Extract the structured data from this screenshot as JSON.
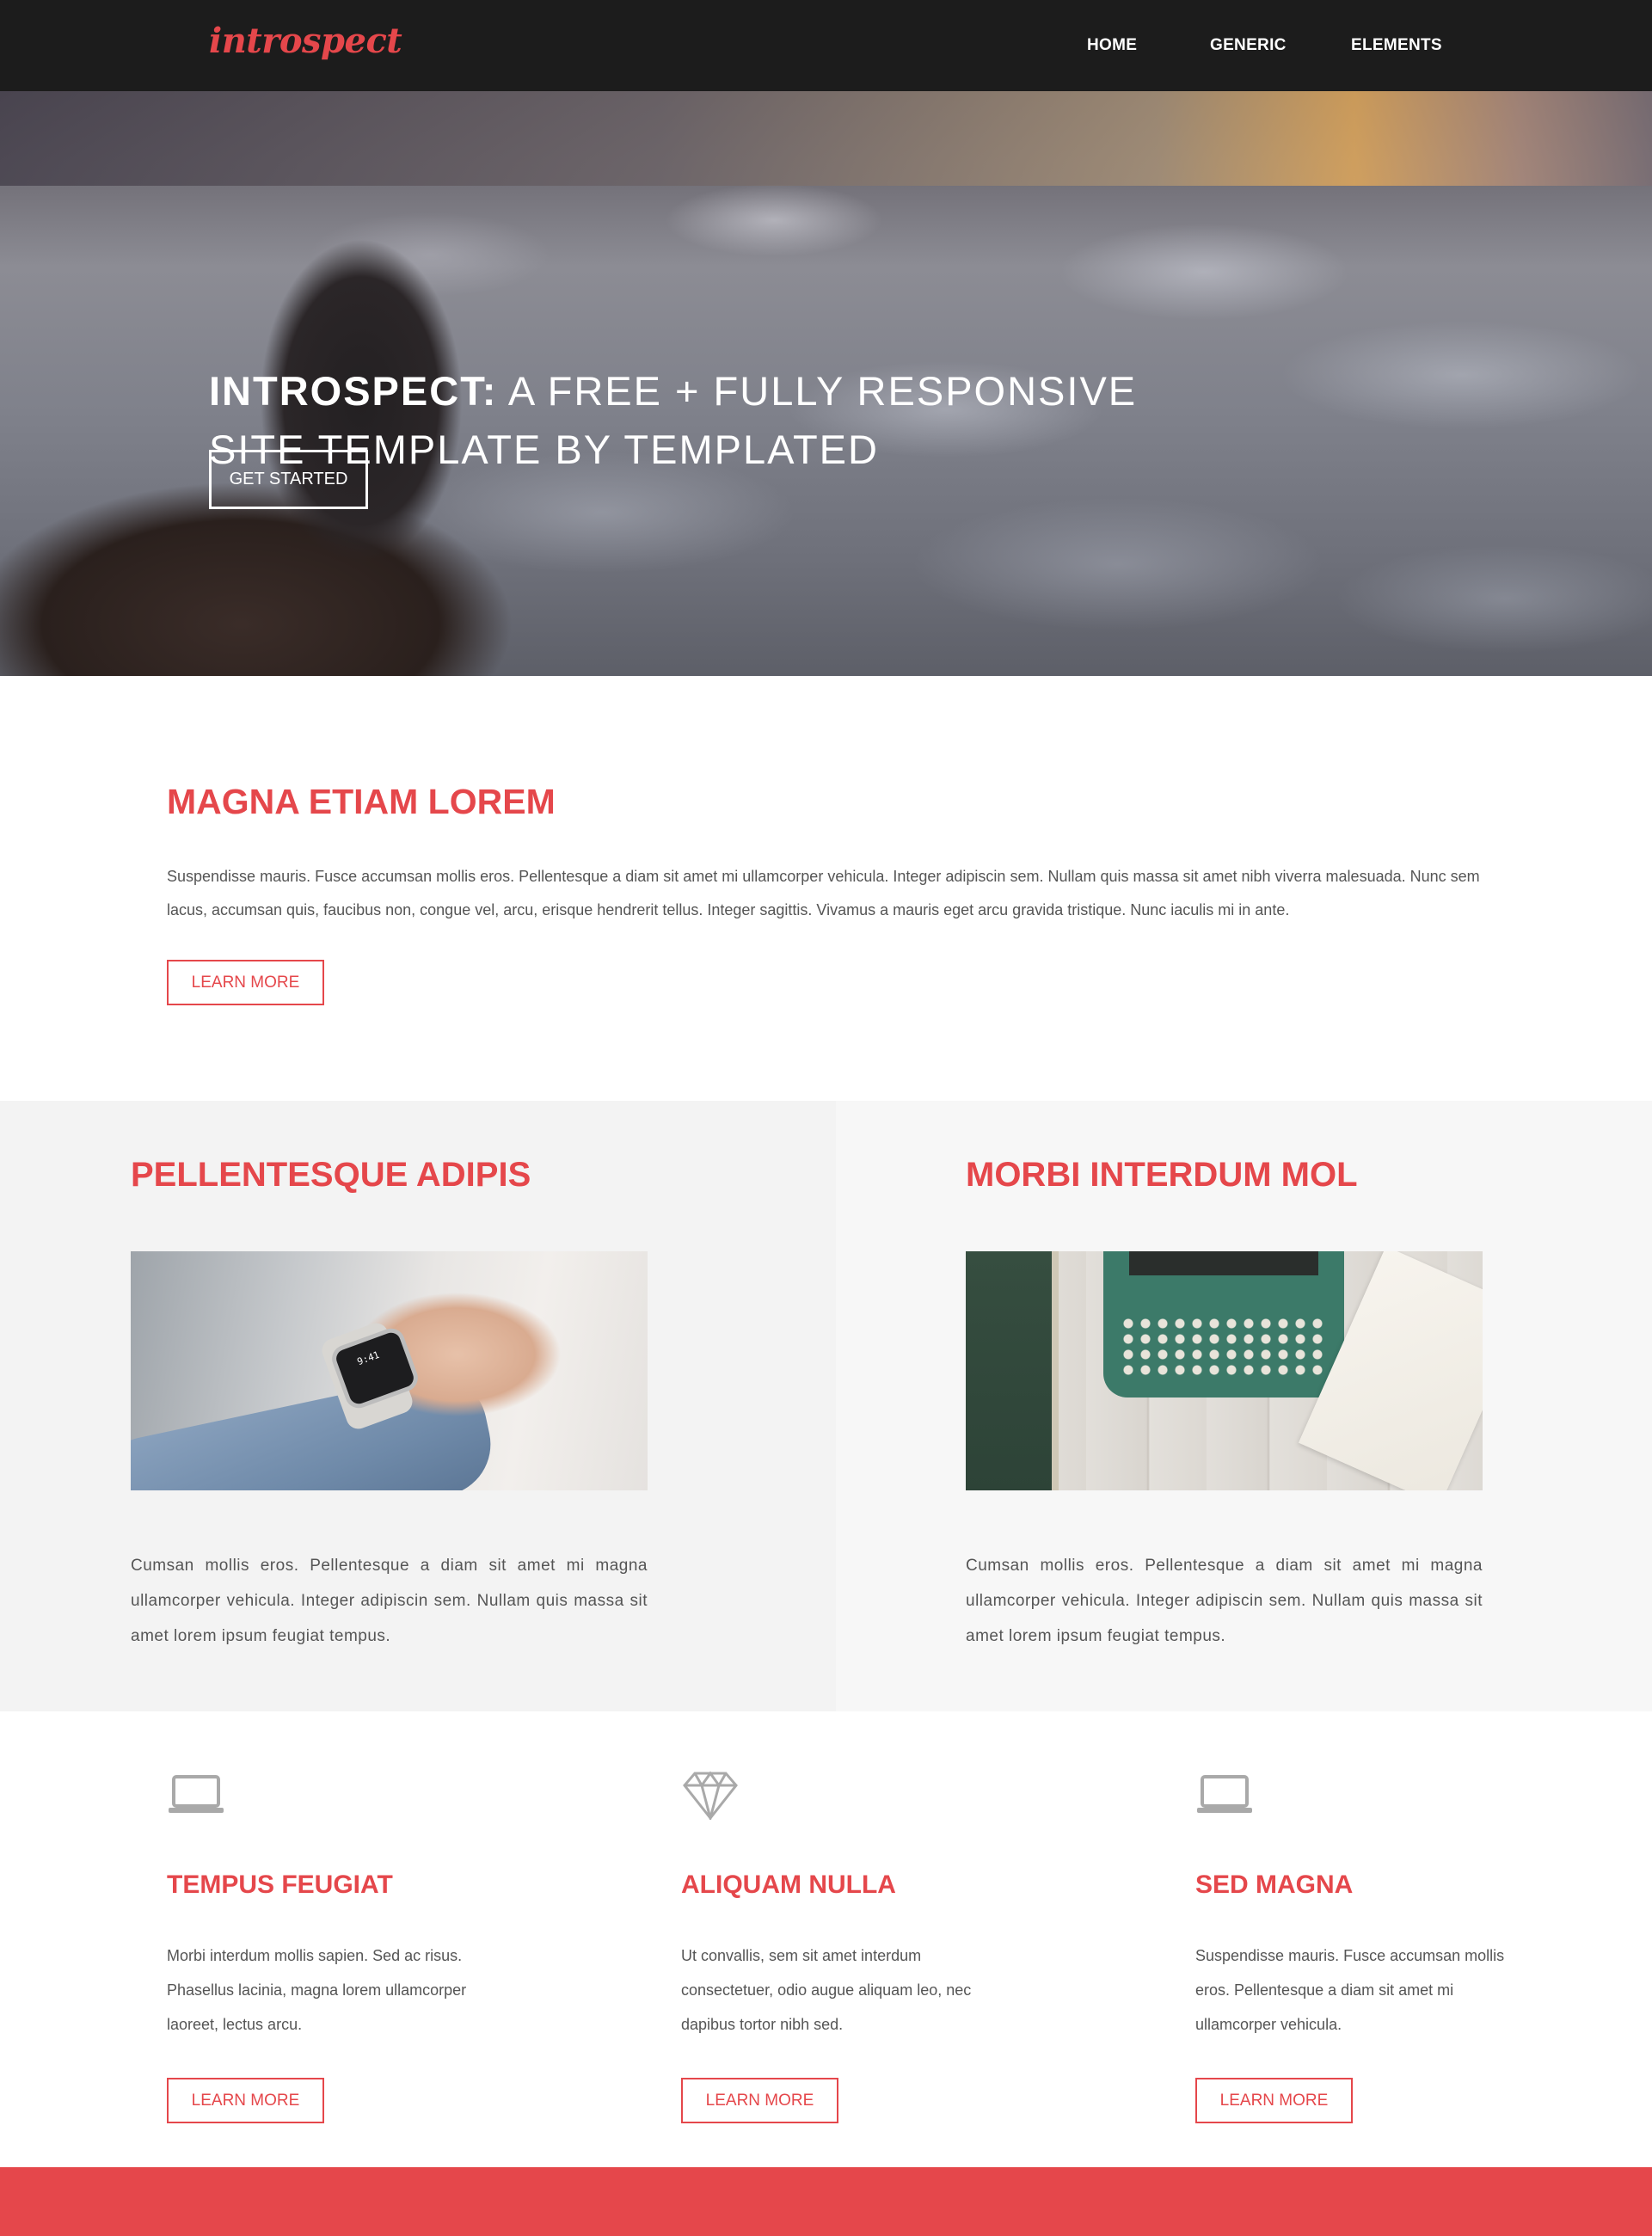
{
  "header": {
    "logo": "introspect",
    "nav": [
      "HOME",
      "GENERIC",
      "ELEMENTS"
    ]
  },
  "hero": {
    "title_bold": "INTROSPECT:",
    "title_rest": " A FREE + FULLY RESPONSIVE SITE TEMPLATE BY TEMPLATED",
    "button": "GET STARTED"
  },
  "intro": {
    "heading": "MAGNA ETIAM LOREM",
    "text": "Suspendisse mauris. Fusce accumsan mollis eros. Pellentesque a diam sit amet mi ullamcorper vehicula. Integer adipiscin sem. Nullam quis massa sit amet nibh viverra malesuada. Nunc sem lacus, accumsan quis, faucibus non, congue vel, arcu, erisque hendrerit tellus. Integer sagittis. Vivamus a mauris eget arcu gravida tristique. Nunc iaculis mi in ante.",
    "button": "LEARN MORE"
  },
  "columns": [
    {
      "heading": "PELLENTESQUE ADIPIS",
      "image": "smartwatch-photo",
      "watch_time": "9:41",
      "text": "Cumsan mollis eros. Pellentesque a diam sit amet mi magna ullamcorper vehicula. Integer adipiscin sem. Nullam quis massa sit amet lorem ipsum feugiat tempus."
    },
    {
      "heading": "MORBI INTERDUM MOL",
      "image": "typewriter-photo",
      "text": "Cumsan mollis eros. Pellentesque a diam sit amet mi magna ullamcorper vehicula. Integer adipiscin sem. Nullam quis massa sit amet lorem ipsum feugiat tempus."
    }
  ],
  "features": [
    {
      "icon": "laptop-icon",
      "heading": "TEMPUS FEUGIAT",
      "text": "Morbi interdum mollis sapien. Sed ac risus. Phasellus lacinia, magna lorem ullamcorper laoreet, lectus arcu.",
      "button": "LEARN MORE"
    },
    {
      "icon": "diamond-icon",
      "heading": "ALIQUAM NULLA",
      "text": "Ut convallis, sem sit amet interdum consectetuer, odio augue aliquam leo, nec dapibus tortor nibh sed.",
      "button": "LEARN MORE"
    },
    {
      "icon": "laptop-icon",
      "heading": "SED MAGNA",
      "text": "Suspendisse mauris. Fusce accumsan mollis eros. Pellentesque a diam sit amet mi ullamcorper vehicula.",
      "button": "LEARN MORE"
    }
  ],
  "colors": {
    "accent": "#e5474b",
    "header_bg": "#1c1c1c",
    "panel_left": "#f3f3f3",
    "panel_right": "#f7f7f7",
    "icon_gray": "#a9a9a9"
  }
}
